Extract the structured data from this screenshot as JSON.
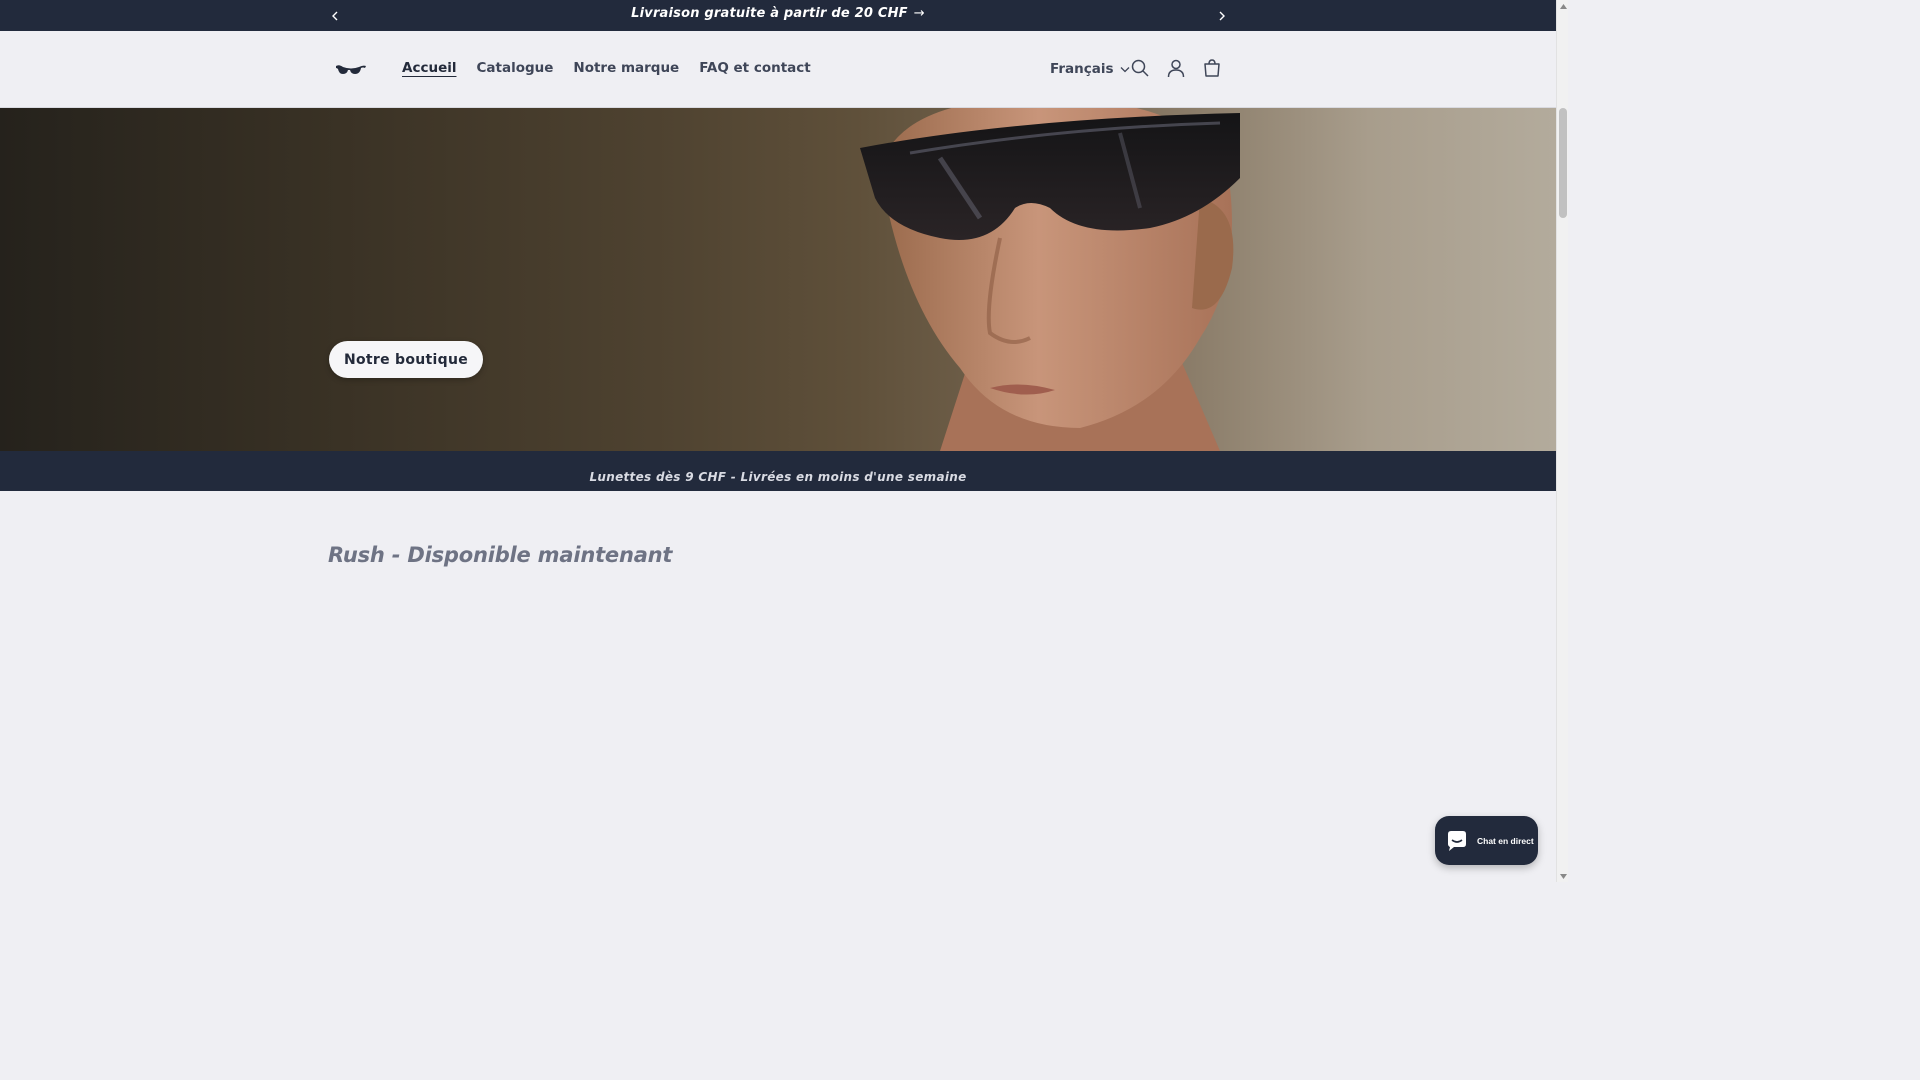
{
  "announcement": {
    "text": "Livraison gratuite à partir de 20 CHF",
    "arrow": "→",
    "prev_icon": "chevron-left-icon",
    "next_icon": "chevron-right-icon"
  },
  "header": {
    "logo_icon": "sunglasses-logo-icon",
    "nav": [
      {
        "label": "Accueil",
        "active": true
      },
      {
        "label": "Catalogue",
        "active": false
      },
      {
        "label": "Notre marque",
        "active": false
      },
      {
        "label": "FAQ et contact",
        "active": false
      }
    ],
    "language": "Français",
    "icons": [
      "search-icon",
      "account-icon",
      "cart-icon"
    ]
  },
  "hero": {
    "button_label": "Notre boutique"
  },
  "strip": {
    "text": "Lunettes dès 9 CHF - Livrées en moins d'une semaine"
  },
  "section": {
    "title": "Rush - Disponible maintenant"
  },
  "chat": {
    "label": "Chat en direct",
    "icon": "chat-bubble-icon"
  },
  "colors": {
    "primary_dark": "#222a3c",
    "background": "#efeff3",
    "muted_title": "#6e7384"
  }
}
